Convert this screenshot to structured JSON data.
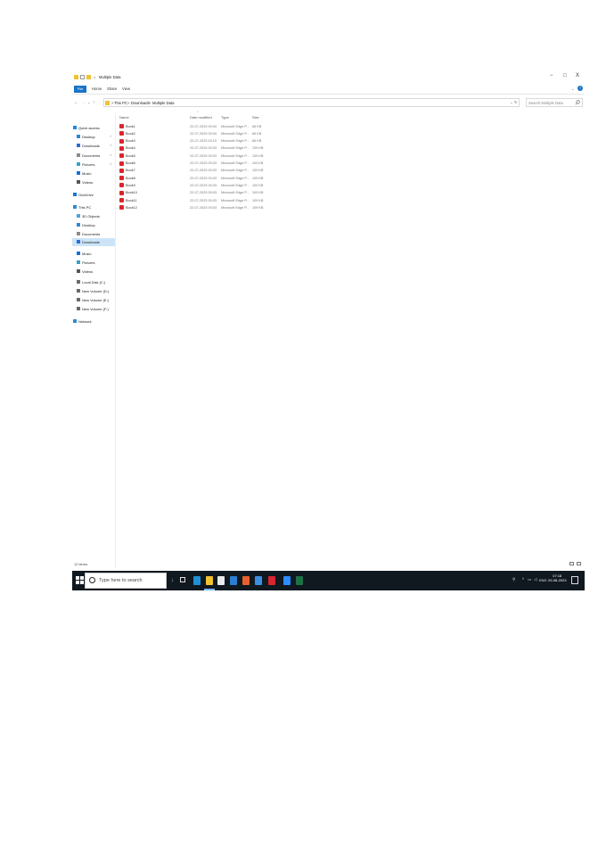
{
  "window": {
    "title": "Multiple Data",
    "title_separator": "=",
    "controls": {
      "minimize": "−",
      "maximize": "□",
      "close": "X"
    }
  },
  "ribbon": {
    "file_tab": "File",
    "tabs": [
      "Home",
      "Share",
      "View"
    ],
    "expand": "⌄",
    "help": "?"
  },
  "address_bar": {
    "back": "←",
    "forward": "→",
    "recent": "⌄",
    "up": "↑",
    "breadcrumb": [
      "This PC",
      "Downloads",
      "Multiple Data"
    ],
    "separator": ">",
    "dropdown": "⌄",
    "refresh": "↻",
    "search_placeholder": "Search Multiple Data",
    "search_icon": "search-icon"
  },
  "nav_pane": {
    "items": [
      {
        "label": "Quick access",
        "icon": "star-icon",
        "color": "#1e88e5",
        "pinned": false
      },
      {
        "label": "Desktop",
        "icon": "desktop-icon",
        "color": "#2a8ad4",
        "pinned": true
      },
      {
        "label": "Downloads",
        "icon": "download-icon",
        "color": "#2a6fd4",
        "pinned": true
      },
      {
        "label": "Documents",
        "icon": "document-icon",
        "color": "#8c8c8c",
        "pinned": true
      },
      {
        "label": "Pictures",
        "icon": "pictures-icon",
        "color": "#3aa0c8",
        "pinned": true
      },
      {
        "label": "Music",
        "icon": "music-icon",
        "color": "#1b6fd1",
        "pinned": false
      },
      {
        "label": "Videos",
        "icon": "video-icon",
        "color": "#555555",
        "pinned": false
      },
      {
        "label": "OneDrive",
        "icon": "cloud-icon",
        "color": "#1976d2",
        "pinned": false
      },
      {
        "label": "This PC",
        "icon": "computer-icon",
        "color": "#2a8ad4",
        "pinned": false
      },
      {
        "label": "3D Objects",
        "icon": "cube-icon",
        "color": "#4aa3df",
        "pinned": false
      },
      {
        "label": "Desktop",
        "icon": "desktop-icon",
        "color": "#2a8ad4",
        "pinned": false
      },
      {
        "label": "Documents",
        "icon": "document-icon",
        "color": "#8c8c8c",
        "pinned": false
      },
      {
        "label": "Downloads",
        "icon": "download-icon",
        "color": "#2a6fd4",
        "pinned": false,
        "selected": true
      },
      {
        "label": "Music",
        "icon": "music-icon",
        "color": "#1b6fd1",
        "pinned": false
      },
      {
        "label": "Pictures",
        "icon": "pictures-icon",
        "color": "#3aa0c8",
        "pinned": false
      },
      {
        "label": "Videos",
        "icon": "video-icon",
        "color": "#555555",
        "pinned": false
      },
      {
        "label": "Local Disk (C:)",
        "icon": "drive-icon",
        "color": "#6a6a6a",
        "pinned": false
      },
      {
        "label": "New Volume (D:)",
        "icon": "drive-icon",
        "color": "#6a6a6a",
        "pinned": false
      },
      {
        "label": "New Volume (E:)",
        "icon": "drive-icon",
        "color": "#6a6a6a",
        "pinned": false
      },
      {
        "label": "New Volume (F:)",
        "icon": "drive-icon",
        "color": "#6a6a6a",
        "pinned": false
      },
      {
        "label": "Network",
        "icon": "network-icon",
        "color": "#2a8ad4",
        "pinned": false
      }
    ],
    "pin_glyph": "✓"
  },
  "file_list": {
    "sort_indicator": "^",
    "columns": [
      "Name",
      "Date modified",
      "Type",
      "Size"
    ],
    "rows": [
      {
        "name": "Book1",
        "date": "22-07-2023 00:04",
        "type": "Microsoft Edge P...",
        "size": "66 KB"
      },
      {
        "name": "Book2",
        "date": "22-07-2023 00:04",
        "type": "Microsoft Edge P...",
        "size": "66 KB"
      },
      {
        "name": "Book3",
        "date": "22-07-2023 00:10",
        "type": "Microsoft Edge P...",
        "size": "66 KB"
      },
      {
        "name": "Book4",
        "date": "22-07-2023 00:03",
        "type": "Microsoft Edge P...",
        "size": "109 KB"
      },
      {
        "name": "Book5",
        "date": "22-07-2023 00:03",
        "type": "Microsoft Edge P...",
        "size": "109 KB"
      },
      {
        "name": "Book6",
        "date": "22-07-2023 00:03",
        "type": "Microsoft Edge P...",
        "size": "109 KB"
      },
      {
        "name": "Book7",
        "date": "22-07-2023 00:03",
        "type": "Microsoft Edge P...",
        "size": "109 KB"
      },
      {
        "name": "Book8",
        "date": "22-07-2023 00:03",
        "type": "Microsoft Edge P...",
        "size": "109 KB"
      },
      {
        "name": "Book9",
        "date": "22-07-2023 00:03",
        "type": "Microsoft Edge P...",
        "size": "109 KB"
      },
      {
        "name": "Book10",
        "date": "22-07-2023 00:03",
        "type": "Microsoft Edge P...",
        "size": "109 KB"
      },
      {
        "name": "Book11",
        "date": "22-07-2023 00:03",
        "type": "Microsoft Edge P...",
        "size": "109 KB"
      },
      {
        "name": "Book12",
        "date": "22-07-2023 00:03",
        "type": "Microsoft Edge P...",
        "size": "109 KB"
      }
    ]
  },
  "status_bar": {
    "item_count": "12 items"
  },
  "taskbar": {
    "search_placeholder": "Type here to search",
    "apps": [
      {
        "icon": "edge-icon",
        "color": "#1e90d6"
      },
      {
        "icon": "file-explorer-icon",
        "color": "#f1c232"
      },
      {
        "icon": "store-icon",
        "color": "#eaeaea"
      },
      {
        "icon": "mail-icon",
        "color": "#2a7fd4"
      },
      {
        "icon": "firefox-icon",
        "color": "#e8612c"
      },
      {
        "icon": "music-icon",
        "color": "#3d8fe0"
      },
      {
        "icon": "media-icon",
        "color": "#d9262e"
      },
      {
        "icon": "zoom-icon",
        "color": "#2d8cff"
      },
      {
        "icon": "excel-icon",
        "color": "#1e7145"
      }
    ],
    "tray": {
      "language": "ENG",
      "time": "07:18",
      "date": "29-08-2023",
      "chevron": "^"
    }
  }
}
